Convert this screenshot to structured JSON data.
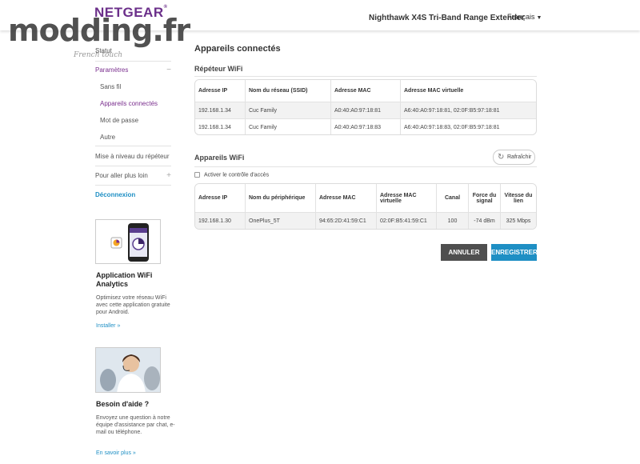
{
  "header": {
    "logo": "NETGEAR",
    "logo_mark": "®",
    "watermark": "modding.fr",
    "watermark_sub": "French touch",
    "product": "Nighthawk X4S Tri-Band Range Extender",
    "language": "Français"
  },
  "sidebar": {
    "status": "Statut",
    "settings": "Paramètres",
    "settings_toggle": "−",
    "sub_items": [
      "Sans fil",
      "Appareils connectés",
      "Mot de passe",
      "Autre"
    ],
    "upgrade": "Mise à niveau du répéteur",
    "more": "Pour aller plus loin",
    "more_toggle": "+",
    "logout": "Déconnexion",
    "app_promo": {
      "title": "Application WiFi Analytics",
      "text": "Optimisez votre réseau WiFi avec cette application gratuite pour Android.",
      "link": "Installer »"
    },
    "help_promo": {
      "title": "Besoin d'aide ?",
      "text": "Envoyez une question à notre équipe d'assistance par chat, e-mail ou téléphone.",
      "link": "En savoir plus »"
    }
  },
  "main": {
    "title": "Appareils connectés",
    "repeater": {
      "title": "Répéteur WiFi",
      "headers": [
        "Adresse IP",
        "Nom du réseau (SSID)",
        "Adresse MAC",
        "Adresse MAC virtuelle"
      ],
      "rows": [
        [
          "192.168.1.34",
          "Cuc Family",
          "A0:40:A0:97:18:81",
          "A6:40:A0:97:18:81, 02:0F:B5:97:18:81"
        ],
        [
          "192.168.1.34",
          "Cuc Family",
          "A0:40:A0:97:18:83",
          "A6:40:A0:97:18:83, 02:0F:B5:97:18:81"
        ]
      ]
    },
    "wifi_devices": {
      "title": "Appareils WiFi",
      "refresh": "Rafraîchir",
      "access_control": "Activer le contrôle d'accès",
      "headers": [
        "Adresse IP",
        "Nom du périphérique",
        "Adresse MAC",
        "Adresse MAC virtuelle",
        "Canal",
        "Force du signal",
        "Vitesse du lien"
      ],
      "rows": [
        [
          "192.168.1.30",
          "OnePlus_5T",
          "94:65:2D:41:59:C1",
          "02:0F:B5:41:59:C1",
          "100",
          "-74 dBm",
          "325 Mbps"
        ]
      ]
    },
    "cancel": "ANNULER",
    "save": "ENREGISTRER"
  }
}
